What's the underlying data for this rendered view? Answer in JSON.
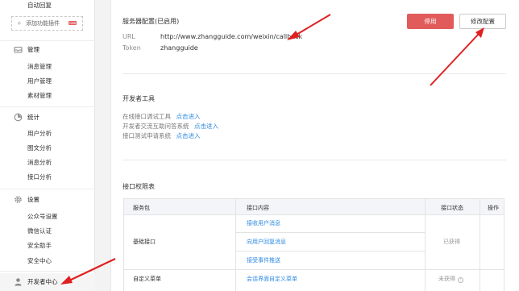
{
  "sidebar": {
    "top_item": "自动回复",
    "add_plugin": {
      "label": "添加功能插件",
      "badge": "new"
    },
    "sections": [
      {
        "title": "管理",
        "icon": "mail-icon",
        "items": [
          "消息管理",
          "用户管理",
          "素材管理"
        ]
      },
      {
        "title": "统计",
        "icon": "stats-icon",
        "items": [
          "用户分析",
          "图文分析",
          "消息分析",
          "接口分析"
        ]
      },
      {
        "title": "设置",
        "icon": "gear-icon",
        "items": [
          "公众号设置",
          "微信认证",
          "安全助手",
          "安全中心"
        ]
      }
    ],
    "developer": {
      "title": "开发者中心",
      "icon": "user-icon"
    }
  },
  "server_config": {
    "title": "服务器配置(已启用)",
    "url_label": "URL",
    "url_value": "http://www.zhangguide.com/weixin/callback",
    "token_label": "Token",
    "token_value": "zhangguide",
    "disable_button": "停用",
    "modify_button": "修改配置"
  },
  "dev_tools": {
    "title": "开发者工具",
    "rows": [
      {
        "label": "在线接口调试工具",
        "link": "点击进入"
      },
      {
        "label": "开发者交流互助问答系统",
        "link": "点击进入"
      },
      {
        "label": "接口测试申请系统",
        "link": "点击进入"
      }
    ]
  },
  "permissions": {
    "title": "接口权限表",
    "headers": [
      "服务包",
      "接口内容",
      "接口状态",
      "操作"
    ],
    "rows": [
      {
        "package": "基础接口",
        "items": [
          "接收用户消息",
          "向用户回复消息",
          "接受事件推送"
        ],
        "status": "已获得"
      },
      {
        "package": "自定义菜单",
        "items": [
          "会话界面自定义菜单"
        ],
        "status": "未获得"
      }
    ]
  },
  "colors": {
    "accent_red": "#e25b5b",
    "link_blue": "#2d8ae0",
    "arrow_red": "#e02020"
  }
}
